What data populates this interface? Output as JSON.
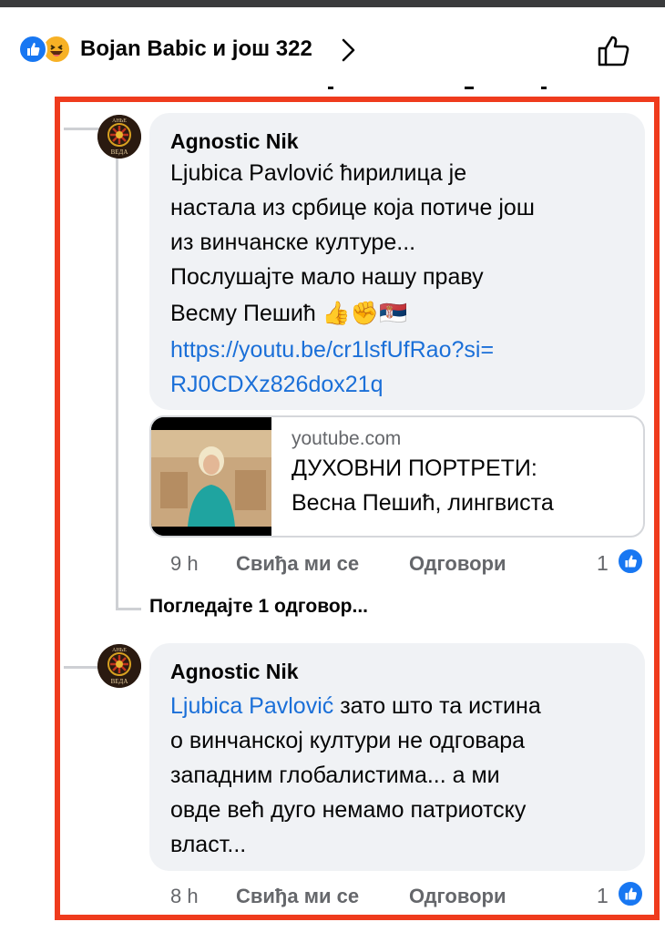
{
  "header": {
    "reactors_text": "Bojan Babic и још 322"
  },
  "comments": [
    {
      "author": "Agnostic Nik",
      "lines": [
        "Ljubica Pavlović ћирилица је",
        "настала из србице која потиче још",
        "из винчанске културе...",
        "Послушајте мало нашу праву",
        "Весму Пешић 👍✊🇷🇸"
      ],
      "link_lines": [
        "https://youtu.be/cr1lsfUfRao?si=",
        "RJ0CDXz826dox21q"
      ],
      "preview": {
        "domain": "youtube.com",
        "title_lines": [
          "ДУХОВНИ ПОРТРЕТИ:",
          "Весна Пешић, лингвиста"
        ]
      },
      "time": "9 h",
      "like_label": "Свиђа ми се",
      "reply_label": "Одговори",
      "like_count": "1"
    },
    {
      "author": "Agnostic Nik",
      "mention": "Ljubica Pavlović",
      "first_line_rest": " зато што та истина",
      "lines": [
        "о винчанској култури не одговара",
        "западним глобалистима... а ми",
        "овде већ дуго немамо патриотску",
        "власт..."
      ],
      "time": "8 h",
      "like_label": "Свиђа ми се",
      "reply_label": "Одговори",
      "like_count": "1"
    }
  ],
  "view_replies": "Погледајте 1 одговор...",
  "colors": {
    "accent": "#1877f2",
    "highlight_border": "#ef3b1d",
    "bubble": "#f0f2f5",
    "secondary_text": "#65676b",
    "link": "#1a6fd8"
  },
  "icons": [
    "like-reaction-icon",
    "haha-reaction-icon",
    "chevron-right-icon",
    "thumbs-up-outline-icon",
    "like-badge-icon"
  ]
}
